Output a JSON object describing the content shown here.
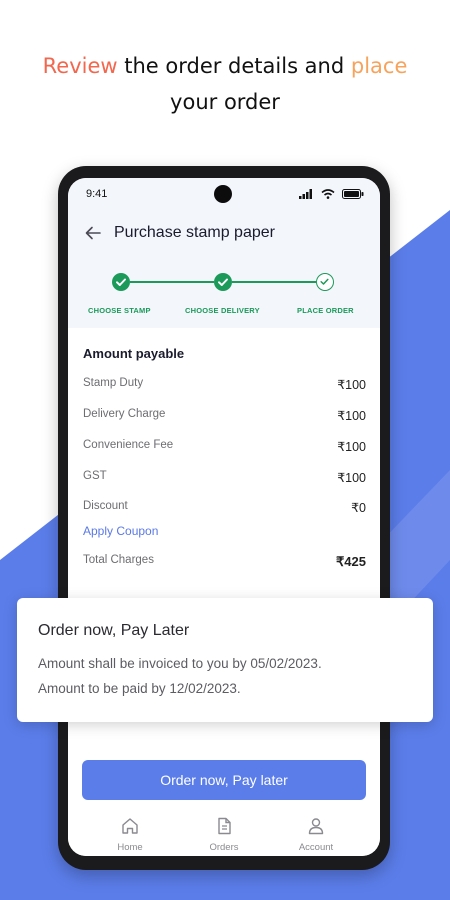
{
  "headline": {
    "word1": "Review",
    "middle": " the order details and ",
    "word2": "place",
    "line2": "your order"
  },
  "colors": {
    "accent_red": "#f2674d",
    "accent_orange": "#f7a35c",
    "brand_blue": "#5b7de9",
    "step_green": "#1b9a5a"
  },
  "status_bar": {
    "time": "9:41",
    "icons": [
      "signal-icon",
      "wifi-icon",
      "battery-icon"
    ]
  },
  "appbar": {
    "back_icon": "arrow-left-icon",
    "title": "Purchase stamp paper"
  },
  "stepper": {
    "steps": [
      {
        "label": "CHOOSE STAMP",
        "state": "done"
      },
      {
        "label": "CHOOSE DELIVERY",
        "state": "done"
      },
      {
        "label": "PLACE ORDER",
        "state": "current"
      }
    ]
  },
  "amount": {
    "title": "Amount payable",
    "rows": [
      {
        "label": "Stamp Duty",
        "value": "₹100"
      },
      {
        "label": "Delivery Charge",
        "value": "₹100"
      },
      {
        "label": "Convenience Fee",
        "value": "₹100"
      },
      {
        "label": "GST",
        "value": "₹100"
      },
      {
        "label": "Discount",
        "value": "₹0"
      }
    ],
    "apply_coupon": "Apply Coupon",
    "total_label": "Total Charges",
    "total_value": "₹425"
  },
  "order_button": {
    "label": "Order now, Pay later"
  },
  "bottom_nav": [
    {
      "label": "Home",
      "icon": "home-icon"
    },
    {
      "label": "Orders",
      "icon": "document-icon"
    },
    {
      "label": "Account",
      "icon": "person-icon"
    }
  ],
  "popup": {
    "title": "Order now, Pay Later",
    "line1": "Amount shall be invoiced to you by 05/02/2023.",
    "line2": "Amount to be paid by 12/02/2023."
  }
}
